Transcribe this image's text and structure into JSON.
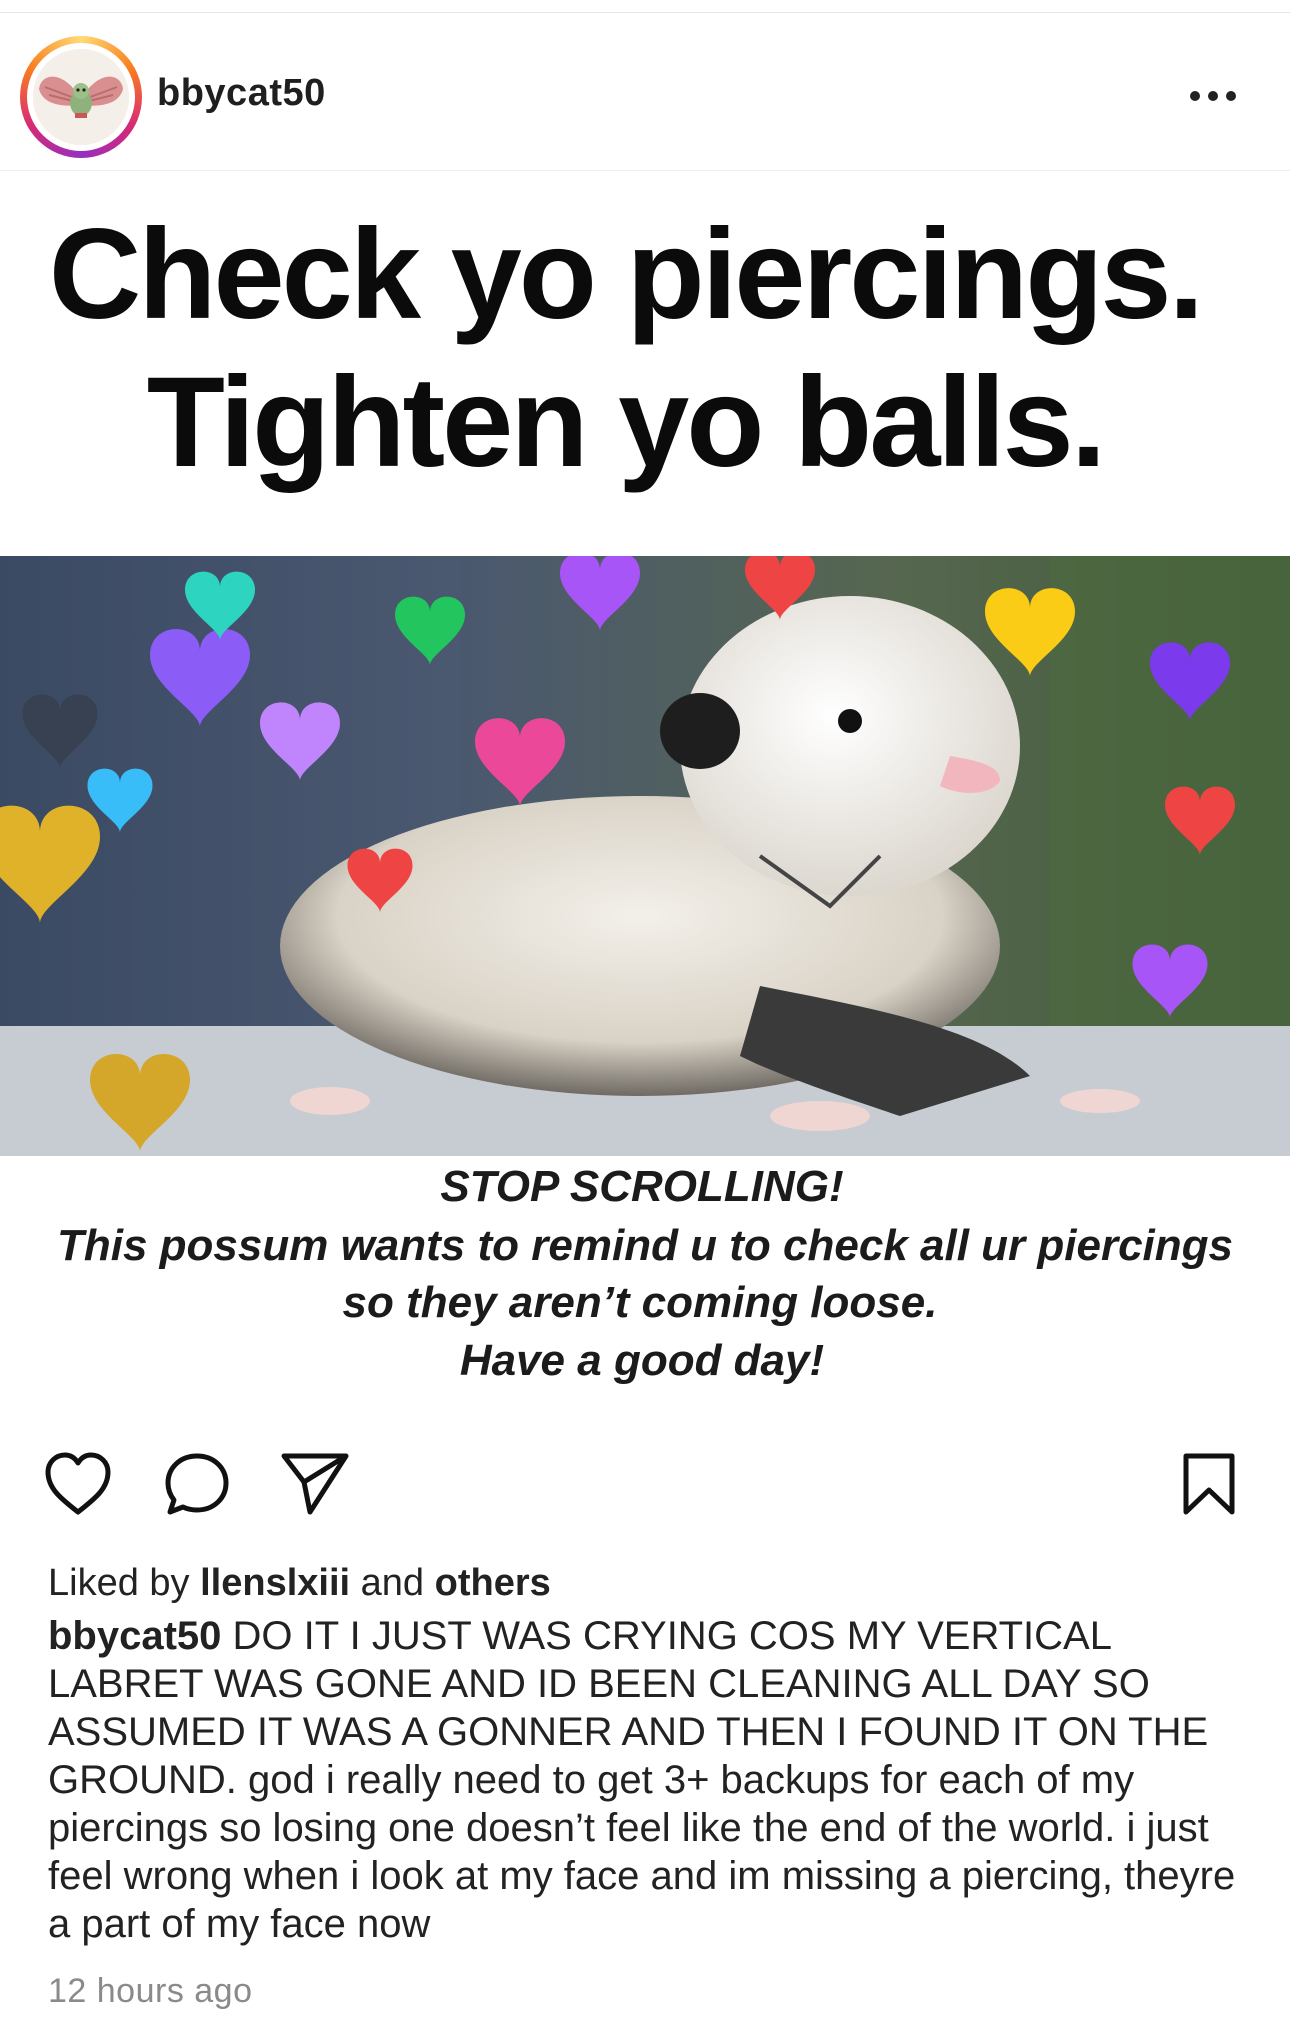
{
  "post": {
    "username": "bbycat50",
    "image_text": {
      "headline_line1": "Check yo piercings.",
      "headline_line2": "Tighten yo balls.",
      "line1": "STOP SCROLLING!",
      "line2": "This possum wants to remind u to check all ur piercings",
      "line3": "so they aren’t coming loose.",
      "line4": "Have a good day!"
    },
    "likes": {
      "prefix": "Liked by",
      "user": "llenslxiii",
      "mid": "and",
      "suffix": "others"
    },
    "caption": {
      "username": "bbycat50",
      "text": "DO IT I JUST WAS CRYING COS MY VERTICAL LABRET WAS GONE AND ID BEEN CLEANING ALL DAY SO ASSUMED IT WAS A GONNER AND THEN I FOUND IT ON THE GROUND. god i really need to get 3+ backups for each of my piercings so losing one doesn’t feel like the end of the world. i just feel wrong when i look at my face and im missing a piercing, theyre a part of my face now"
    },
    "timestamp": "12 hours ago"
  },
  "icons": {
    "more": "more-horizontal-icon",
    "like": "heart-icon",
    "comment": "comment-icon",
    "share": "send-icon",
    "save": "bookmark-icon"
  },
  "colors": {
    "story_ring": [
      "#feda75",
      "#fa7e1e",
      "#d62976",
      "#962fbf"
    ],
    "text": "#222222",
    "muted": "#8a8a8a"
  }
}
